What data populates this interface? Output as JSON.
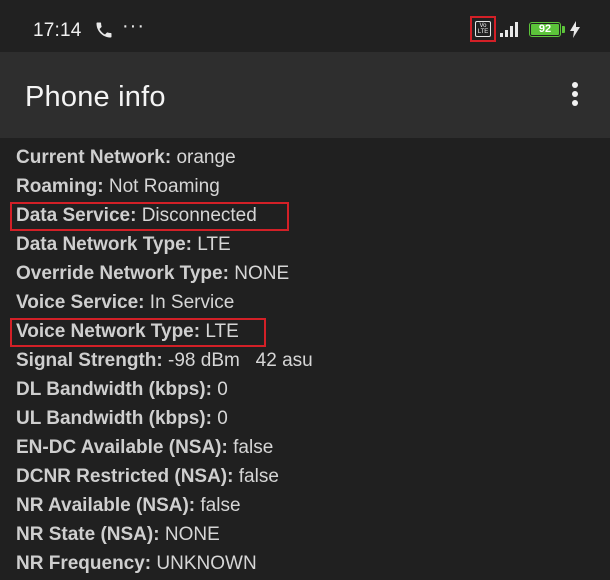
{
  "status_bar": {
    "time": "17:14",
    "more": "···",
    "volte_icon_text_top": "Vo",
    "volte_icon_text_bottom": "LTE",
    "battery_level": "92",
    "icons": [
      "phone-icon",
      "more-dots-icon",
      "volte-icon",
      "signal-icon",
      "battery-icon",
      "charging-bolt-icon"
    ],
    "battery_color": "#5cc43a"
  },
  "app_bar": {
    "title": "Phone info",
    "menu_icon": "overflow-menu-icon"
  },
  "highlight_color": "#d32027",
  "info_rows": [
    {
      "label": "Current Network:",
      "value": "orange"
    },
    {
      "label": "Roaming:",
      "value": "Not Roaming"
    },
    {
      "label": "Data Service:",
      "value": "Disconnected"
    },
    {
      "label": "Data Network Type:",
      "value": "LTE"
    },
    {
      "label": "Override Network Type:",
      "value": "NONE"
    },
    {
      "label": "Voice Service:",
      "value": "In Service"
    },
    {
      "label": "Voice Network Type:",
      "value": "LTE"
    },
    {
      "label": "Signal Strength:",
      "value": "-98 dBm   42 asu"
    },
    {
      "label": "DL Bandwidth (kbps):",
      "value": "0"
    },
    {
      "label": "UL Bandwidth (kbps):",
      "value": "0"
    },
    {
      "label": "EN-DC Available (NSA):",
      "value": "false"
    },
    {
      "label": "DCNR Restricted (NSA):",
      "value": "false"
    },
    {
      "label": "NR Available (NSA):",
      "value": "false"
    },
    {
      "label": "NR State (NSA):",
      "value": "NONE"
    },
    {
      "label": "NR Frequency:",
      "value": "UNKNOWN"
    }
  ]
}
